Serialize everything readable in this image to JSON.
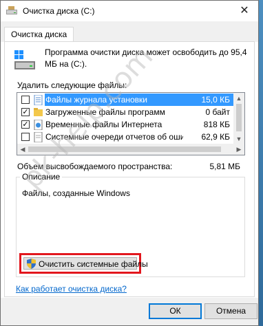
{
  "window": {
    "title": "Очистка диска  (C:)",
    "close_glyph": "✕"
  },
  "tabs": [
    {
      "label": "Очистка диска"
    }
  ],
  "intro": {
    "text": "Программа очистки диска может освободить до 95,4 МБ на  (C:)."
  },
  "files": {
    "label": "Удалить следующие файлы:",
    "items": [
      {
        "name": "Файлы журнала установки",
        "size": "15,0 КБ",
        "checked": false,
        "selected": true,
        "icon": "log-file-icon"
      },
      {
        "name": "Загруженные файлы программ",
        "size": "0 байт",
        "checked": true,
        "selected": false,
        "icon": "folder-icon"
      },
      {
        "name": "Временные файлы Интернета",
        "size": "818 КБ",
        "checked": true,
        "selected": false,
        "icon": "internet-file-icon"
      },
      {
        "name": "Системные очереди отчетов об оши...",
        "size": "62,9 КБ",
        "checked": false,
        "selected": false,
        "icon": "report-file-icon"
      }
    ]
  },
  "space": {
    "label": "Объем высвобождаемого пространства:",
    "value": "5,81 МБ"
  },
  "description": {
    "legend": "Описание",
    "text": "Файлы, созданные Windows"
  },
  "buttons": {
    "cleanup_system": "Очистить системные файлы",
    "ok": "ОК",
    "cancel": "Отмена"
  },
  "links": {
    "how_it_works": "Как работает очистка диска?"
  },
  "watermark": "pk-help.com",
  "colors": {
    "accent": "#3399ff",
    "highlight_border": "#e2161d",
    "link": "#0066cc"
  }
}
